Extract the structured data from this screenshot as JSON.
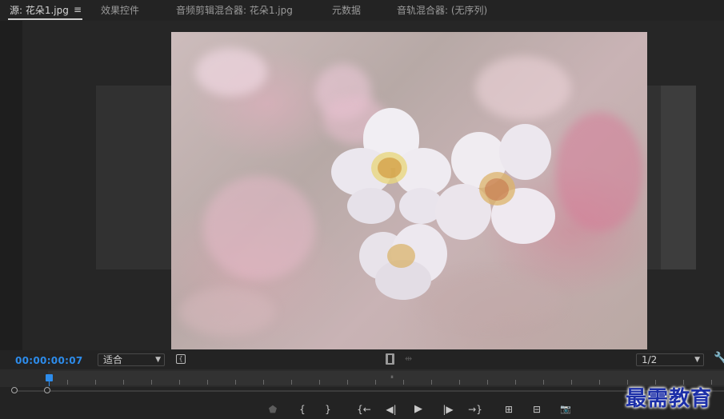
{
  "tabs": [
    {
      "label": "源: 花朵1.jpg",
      "active": true
    },
    {
      "label": "效果控件",
      "active": false
    },
    {
      "label": "音频剪辑混合器: 花朵1.jpg",
      "active": false
    },
    {
      "label": "元数据",
      "active": false
    },
    {
      "label": "音轨混合器: (无序列)",
      "active": false
    }
  ],
  "menu_icon": "≡",
  "viewer": {
    "image_subject": "cherry-blossom-photo",
    "timecode": "00:00:00:07",
    "zoom_select": "适合",
    "resolution_select": "1/2",
    "playhead_position_fraction": 0.0
  },
  "transport": {
    "marker": "⬟",
    "mark_in": "{",
    "mark_out": "}",
    "go_to_in": "{←",
    "step_back": "◀|",
    "play": "▶",
    "step_forward": "|▶",
    "go_to_out": "→}",
    "insert": "⊞",
    "overwrite": "⊟",
    "export_frame": "📷"
  },
  "watermark": "最需教育",
  "colors": {
    "accent_timecode": "#2d8ceb",
    "panel_bg": "#232323",
    "watermark": "#1c2fa8"
  }
}
